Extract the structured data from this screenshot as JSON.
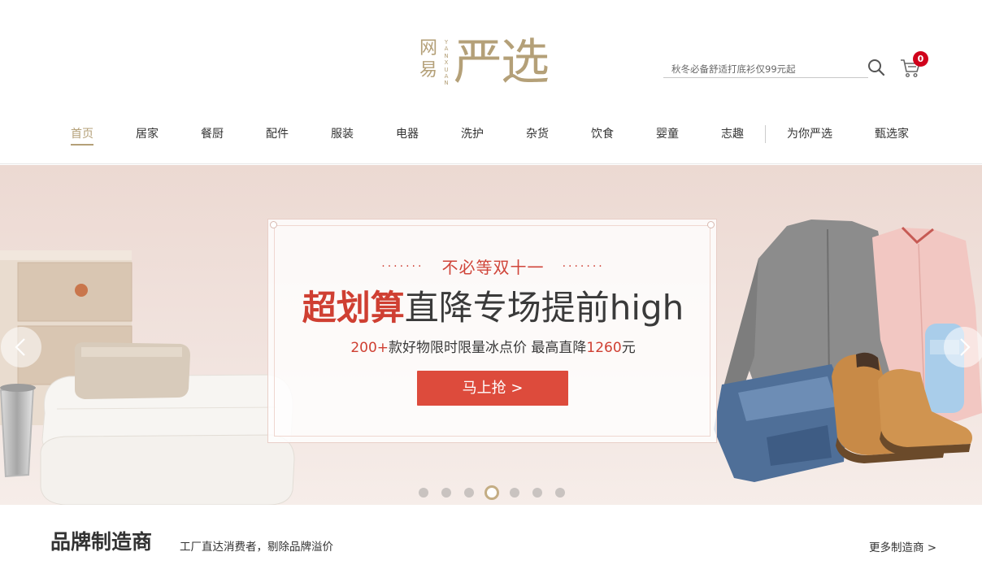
{
  "brand": {
    "small": "网易",
    "pinyin": "YANXUAN",
    "big": "严选",
    "color": "#b4a078"
  },
  "search": {
    "placeholder": "秋冬必备舒适打底衫仅99元起",
    "icon": "search-icon"
  },
  "cart": {
    "icon": "cart-icon",
    "count": "0",
    "badge_color": "#d0021b"
  },
  "nav": {
    "items": [
      {
        "label": "首页",
        "active": true
      },
      {
        "label": "居家"
      },
      {
        "label": "餐厨"
      },
      {
        "label": "配件"
      },
      {
        "label": "服装"
      },
      {
        "label": "电器"
      },
      {
        "label": "洗护"
      },
      {
        "label": "杂货"
      },
      {
        "label": "饮食"
      },
      {
        "label": "婴童"
      },
      {
        "label": "志趣"
      },
      {
        "label": "为你严选"
      },
      {
        "label": "甄选家"
      }
    ]
  },
  "banner": {
    "kicker_dots": "·······",
    "kicker": "不必等双十一",
    "headline_red": "超划算",
    "headline_rest": "直降专场提前high",
    "sub_red_1": "200+",
    "sub_mid": "款好物限时限量冰点价  最高直降",
    "sub_red_2": "1260",
    "sub_end": "元",
    "cta": "马上抢 >",
    "cta_color": "#dd4b3c",
    "slide_count": 7,
    "active_slide": 4,
    "prev_icon": "chevron-left-icon",
    "next_icon": "chevron-right-icon"
  },
  "section": {
    "title": "品牌制造商",
    "subtitle": "工厂直达消费者，剔除品牌溢价",
    "more": "更多制造商 >"
  }
}
